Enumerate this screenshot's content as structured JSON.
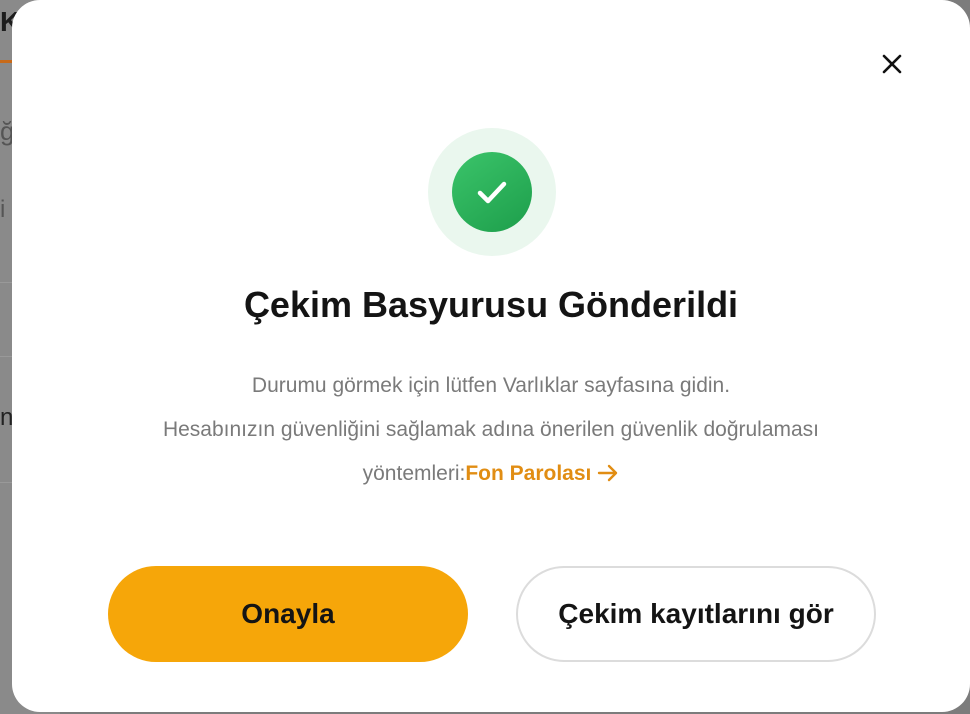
{
  "background": {
    "heading_fragment": "K",
    "line_fragment_1": "ğ",
    "line_fragment_2": "i",
    "line_fragment_3": "n"
  },
  "modal": {
    "close_icon": "close-icon",
    "status_icon": "check-circle-icon",
    "title": "Çekim Basyurusu Gönderildi",
    "description_line_1": "Durumu görmek için lütfen Varlıklar sayfasına gidin.",
    "description_line_2": "Hesabınızın güvenliğini sağlamak adına önerilen güvenlik doğrulaması",
    "description_line_3_prefix": "yöntemleri:",
    "link_label": "Fon Parolası",
    "link_icon": "arrow-right-icon",
    "confirm_label": "Onayla",
    "records_label": "Çekim kayıtlarını gör"
  },
  "colors": {
    "accent": "#f6a609",
    "link": "#e18d13",
    "success": "#27b05a"
  }
}
